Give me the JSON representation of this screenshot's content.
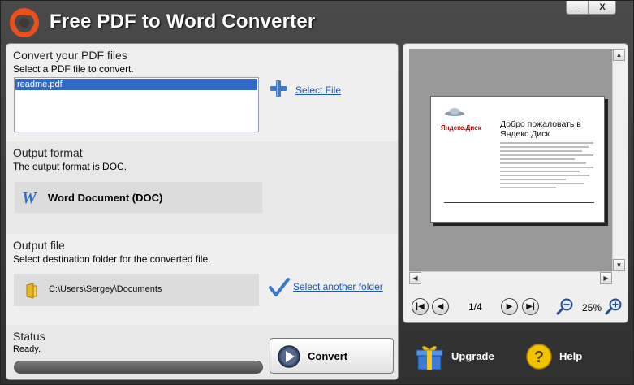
{
  "app": {
    "title": "Free PDF to Word Converter"
  },
  "window_controls": {
    "minimize": "_",
    "close": "X"
  },
  "convert_section": {
    "title": "Convert your PDF files",
    "subtitle": "Select a PDF file to convert.",
    "files": [
      "readme.pdf"
    ],
    "select_file_label": "Select File"
  },
  "output_format": {
    "title": "Output format",
    "subtitle": "The output format is DOC.",
    "format_label": "Word Document (DOC)"
  },
  "output_file": {
    "title": "Output file",
    "subtitle": "Select destination folder for the converted file.",
    "path": "C:\\Users\\Sergey\\Documents",
    "select_folder_label": "Select another folder"
  },
  "status": {
    "title": "Status",
    "text": "Ready.",
    "progress": 0
  },
  "convert_button": {
    "label": "Convert"
  },
  "preview": {
    "page_brand": "Яндекс.Диск",
    "page_heading": "Добро пожаловать в Яндекс.Диск",
    "page_indicator": "1/4",
    "zoom_level": "25%"
  },
  "actions": {
    "upgrade_label": "Upgrade",
    "help_label": "Help"
  },
  "colors": {
    "accent_link": "#1c56b8",
    "selection": "#3169c6",
    "window_bg": "#3a3a3a"
  }
}
